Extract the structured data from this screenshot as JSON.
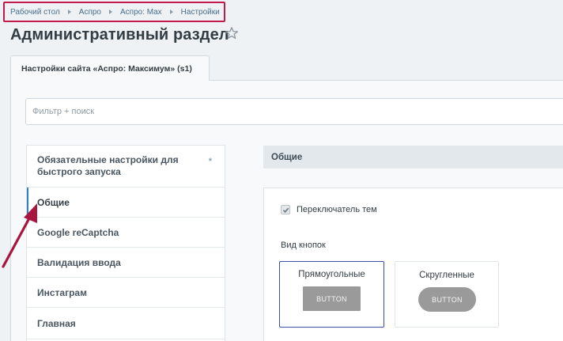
{
  "breadcrumb": {
    "items": [
      "Рабочий стол",
      "Аспро",
      "Аспро: Max",
      "Настройки"
    ]
  },
  "page": {
    "title": "Административный раздел"
  },
  "tab": {
    "label": "Настройки сайта «Аспро: Максимум» (s1)"
  },
  "filter": {
    "placeholder": "Фильтр + поиск"
  },
  "sidebar": {
    "items": [
      {
        "label": "Обязательные настройки для быстрого запуска",
        "mark": "*"
      },
      {
        "label": "Общие"
      },
      {
        "label": "Google reCaptcha"
      },
      {
        "label": "Валидация ввода"
      },
      {
        "label": "Инстаграм"
      },
      {
        "label": "Главная"
      }
    ],
    "active_index": 1
  },
  "section": {
    "title": "Общие",
    "theme_switcher": {
      "label": "Переключатель тем",
      "checked": true
    },
    "buttons_view": {
      "label": "Вид кнопок",
      "options": [
        {
          "title": "Прямоугольные",
          "button_text": "BUTTON",
          "selected": true
        },
        {
          "title": "Скругленные",
          "button_text": "BUTTON",
          "selected": false
        }
      ]
    }
  },
  "colors": {
    "highlight_frame": "#c21b4b",
    "active_accent": "#2f7fc1",
    "selected_card": "#3b4fa8"
  }
}
